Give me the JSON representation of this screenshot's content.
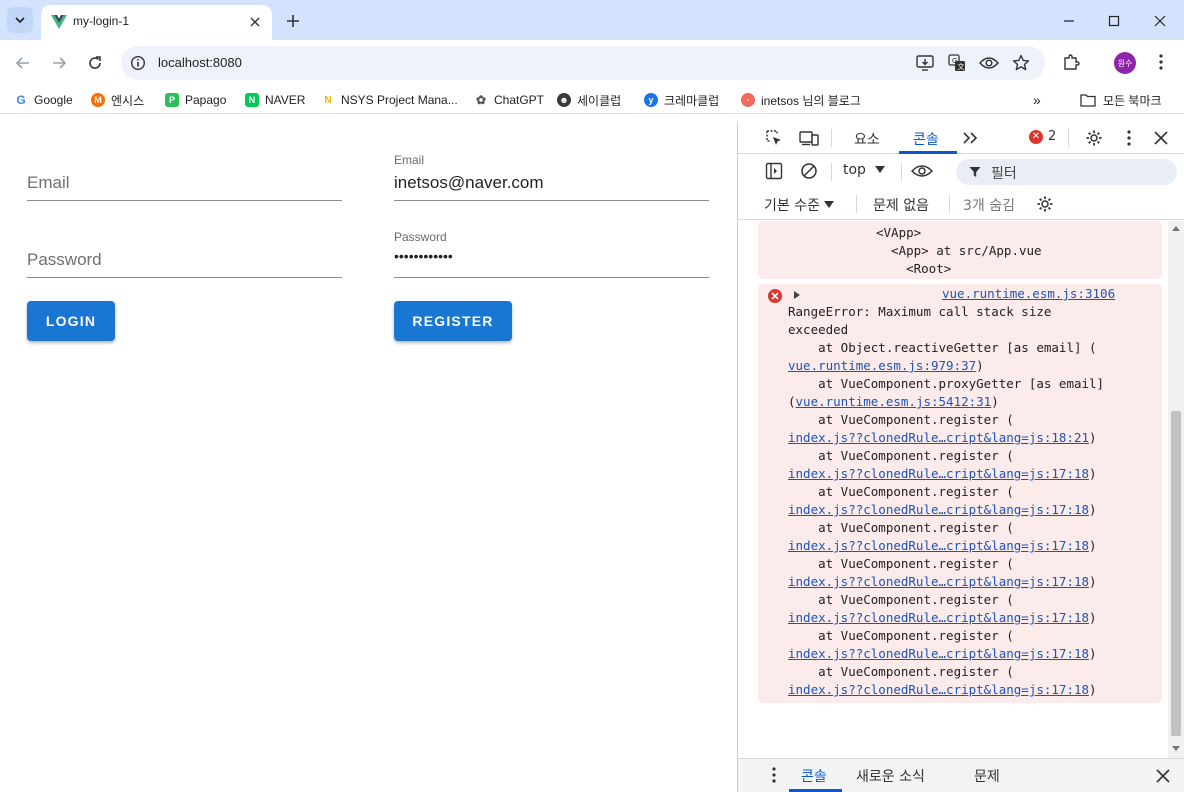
{
  "browser": {
    "tab_title": "my-login-1",
    "url": "localhost:8080",
    "avatar_text": "원수"
  },
  "bookmarks": [
    {
      "label": "Google",
      "icon": "google-icon",
      "color": "#4285f4"
    },
    {
      "label": "엔시스",
      "icon": "m-icon",
      "color": "#ff6d00"
    },
    {
      "label": "Papago",
      "icon": "papago-icon",
      "color": "#2bbf5a"
    },
    {
      "label": "NAVER",
      "icon": "naver-icon",
      "color": "#03c75a"
    },
    {
      "label": "NSYS Project Mana...",
      "icon": "nsys-icon",
      "color": "#f2b600"
    },
    {
      "label": "ChatGPT",
      "icon": "chatgpt-icon",
      "color": "#555555"
    },
    {
      "label": "세이클럽",
      "icon": "sayclub-icon",
      "color": "#222222"
    },
    {
      "label": "크레마클럽",
      "icon": "crema-icon",
      "color": "#1a73e8"
    },
    {
      "label": "inetsos 님의 블로그",
      "icon": "blog-icon",
      "color": "#f06a5f"
    }
  ],
  "all_bookmarks": "모든 북마크",
  "login_form": {
    "email_label": "Email",
    "password_label": "Password",
    "button": "LOGIN"
  },
  "register_form": {
    "email_label": "Email",
    "email_value": "inetsos@naver.com",
    "password_label": "Password",
    "password_value": "••••••••••••",
    "button": "REGISTER"
  },
  "devtools": {
    "tabs": [
      "요소",
      "콘솔"
    ],
    "active_tab": "콘솔",
    "error_count": "2",
    "context": "top",
    "filter_placeholder": "필터",
    "level": "기본 수준",
    "issues": "문제 없음",
    "hidden": "3개 숨김",
    "drawer_tabs": [
      "콘솔",
      "새로운 소식",
      "문제"
    ]
  },
  "console": {
    "prev_lines": [
      "<VApp>",
      "  <App> at src/App.vue",
      "    <Root>"
    ],
    "error": {
      "source": "vue.runtime.esm.js:3106",
      "message_1": "RangeError: Maximum call stack size",
      "message_2": "exceeded",
      "frames": [
        {
          "fn": "    at Object.reactiveGetter [as email] (",
          "loc": "vue.runtime.esm.js:979:37",
          "tail": ")",
          "lead": ""
        },
        {
          "fn": "    at VueComponent.proxyGetter [as email]",
          "loc": "vue.runtime.esm.js:5412:31",
          "tail": ")",
          "lead": "("
        },
        {
          "fn": "    at VueComponent.register (",
          "loc": "index.js??clonedRule…cript&lang=js:18:21",
          "tail": ")",
          "lead": ""
        },
        {
          "fn": "    at VueComponent.register (",
          "loc": "index.js??clonedRule…cript&lang=js:17:18",
          "tail": ")",
          "lead": ""
        },
        {
          "fn": "    at VueComponent.register (",
          "loc": "index.js??clonedRule…cript&lang=js:17:18",
          "tail": ")",
          "lead": ""
        },
        {
          "fn": "    at VueComponent.register (",
          "loc": "index.js??clonedRule…cript&lang=js:17:18",
          "tail": ")",
          "lead": ""
        },
        {
          "fn": "    at VueComponent.register (",
          "loc": "index.js??clonedRule…cript&lang=js:17:18",
          "tail": ")",
          "lead": ""
        },
        {
          "fn": "    at VueComponent.register (",
          "loc": "index.js??clonedRule…cript&lang=js:17:18",
          "tail": ")",
          "lead": ""
        },
        {
          "fn": "    at VueComponent.register (",
          "loc": "index.js??clonedRule…cript&lang=js:17:18",
          "tail": ")",
          "lead": ""
        },
        {
          "fn": "    at VueComponent.register (",
          "loc": "index.js??clonedRule…cript&lang=js:17:18",
          "tail": ")",
          "lead": ""
        }
      ]
    },
    "prompt": ">"
  },
  "colors": {
    "primary_button": "#1976d2",
    "error_bg": "#fcebeb",
    "error_red": "#dc362e",
    "devtools_accent": "#0b57d0"
  }
}
